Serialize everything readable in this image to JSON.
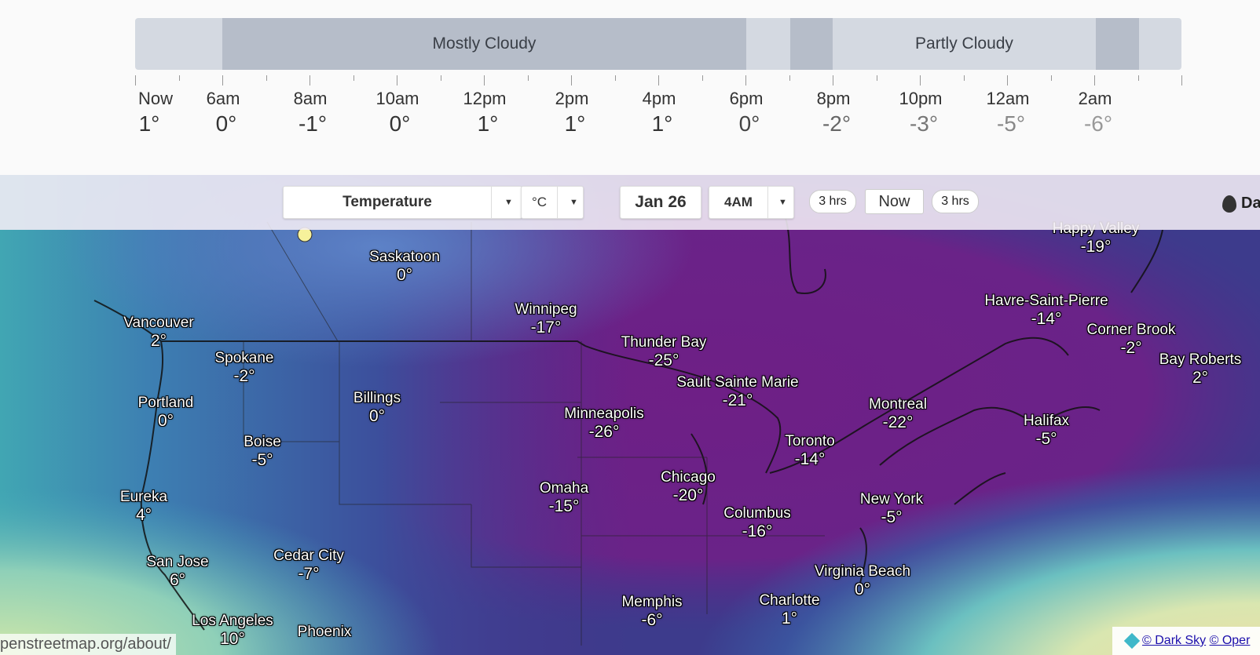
{
  "timeline": {
    "conditions": [
      {
        "label": "Mostly Cloudy"
      },
      {
        "label": "Partly Cloudy"
      }
    ],
    "hours": [
      {
        "label": "Now",
        "temp": "1°",
        "color": "#333333"
      },
      {
        "label": "6am",
        "temp": "0°",
        "color": "#333333"
      },
      {
        "label": "8am",
        "temp": "-1°",
        "color": "#333333"
      },
      {
        "label": "10am",
        "temp": "0°",
        "color": "#333333"
      },
      {
        "label": "12pm",
        "temp": "1°",
        "color": "#333333"
      },
      {
        "label": "2pm",
        "temp": "1°",
        "color": "#333333"
      },
      {
        "label": "4pm",
        "temp": "1°",
        "color": "#333333"
      },
      {
        "label": "6pm",
        "temp": "0°",
        "color": "#444444"
      },
      {
        "label": "8pm",
        "temp": "-2°",
        "color": "#666666"
      },
      {
        "label": "10pm",
        "temp": "-3°",
        "color": "#777777"
      },
      {
        "label": "12am",
        "temp": "-5°",
        "color": "#888888"
      },
      {
        "label": "2am",
        "temp": "-6°",
        "color": "#999999"
      }
    ]
  },
  "controls": {
    "layer": "Temperature",
    "unit": "°C",
    "date": "Jan 26",
    "time": "4AM",
    "back": "3 hrs",
    "now": "Now",
    "forward": "3 hrs",
    "brand": "Da"
  },
  "cities": [
    {
      "name": "Saskatoon",
      "temp": "0°"
    },
    {
      "name": "Happy Valley",
      "temp": "-19°"
    },
    {
      "name": "Winnipeg",
      "temp": "-17°"
    },
    {
      "name": "Havre-Saint-Pierre",
      "temp": "-14°"
    },
    {
      "name": "Vancouver",
      "temp": "2°"
    },
    {
      "name": "Corner Brook",
      "temp": "-2°"
    },
    {
      "name": "Thunder Bay",
      "temp": "-25°"
    },
    {
      "name": "Spokane",
      "temp": "-2°"
    },
    {
      "name": "Bay Roberts",
      "temp": "2°"
    },
    {
      "name": "Sault Sainte Marie",
      "temp": "-21°"
    },
    {
      "name": "Portland",
      "temp": "0°"
    },
    {
      "name": "Billings",
      "temp": "0°"
    },
    {
      "name": "Montreal",
      "temp": "-22°"
    },
    {
      "name": "Minneapolis",
      "temp": "-26°"
    },
    {
      "name": "Halifax",
      "temp": "-5°"
    },
    {
      "name": "Boise",
      "temp": "-5°"
    },
    {
      "name": "Toronto",
      "temp": "-14°"
    },
    {
      "name": "Chicago",
      "temp": "-20°"
    },
    {
      "name": "Omaha",
      "temp": "-15°"
    },
    {
      "name": "Eureka",
      "temp": "4°"
    },
    {
      "name": "New York",
      "temp": "-5°"
    },
    {
      "name": "Columbus",
      "temp": "-16°"
    },
    {
      "name": "Cedar City",
      "temp": "-7°"
    },
    {
      "name": "San Jose",
      "temp": "6°"
    },
    {
      "name": "Virginia Beach",
      "temp": "0°"
    },
    {
      "name": "Memphis",
      "temp": "-6°"
    },
    {
      "name": "Charlotte",
      "temp": "1°"
    },
    {
      "name": "Los Angeles",
      "temp": "10°"
    },
    {
      "name": "Phoenix",
      "temp": ""
    }
  ],
  "attribution": "penstreetmap.org/about/",
  "credits": {
    "darksky": "© Dark Sky",
    "osm": "© Oper"
  }
}
